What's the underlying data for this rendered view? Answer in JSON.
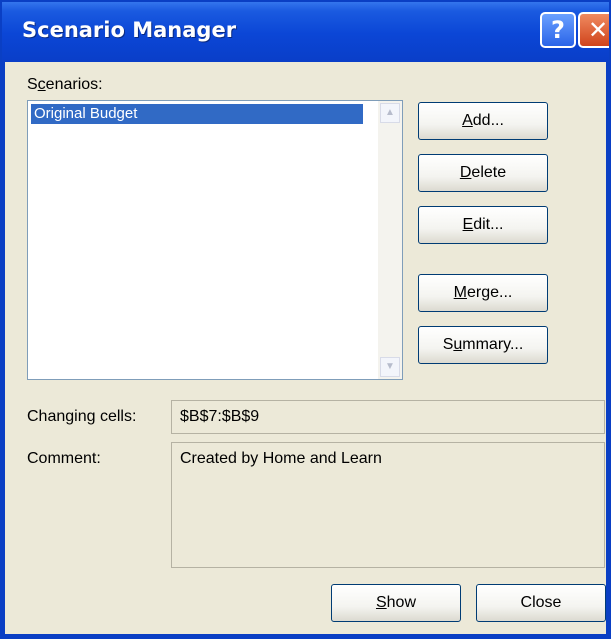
{
  "window": {
    "title": "Scenario Manager",
    "help_glyph": "?",
    "close_glyph": "✕"
  },
  "scenarios": {
    "label_pre": "S",
    "label_key": "c",
    "label_post": "enarios:",
    "items": [
      "Original Budget"
    ],
    "selected_index": 0
  },
  "buttons": {
    "add": {
      "key": "A",
      "rest": "dd..."
    },
    "delete": {
      "key": "D",
      "rest": "elete"
    },
    "edit": {
      "key": "E",
      "rest": "dit..."
    },
    "merge": {
      "key": "M",
      "rest": "erge..."
    },
    "summary": {
      "pre": "S",
      "key": "u",
      "rest": "mmary..."
    },
    "show": {
      "key": "S",
      "rest": "how"
    },
    "close": "Close"
  },
  "changing_cells": {
    "label": "Changing cells:",
    "value": "$B$7:$B$9"
  },
  "comment": {
    "label": "Comment:",
    "value": "Created by Home and Learn"
  },
  "colors": {
    "title_bar": "#0b46d6",
    "selection": "#316ac5",
    "dialog_face": "#ece9d8"
  }
}
